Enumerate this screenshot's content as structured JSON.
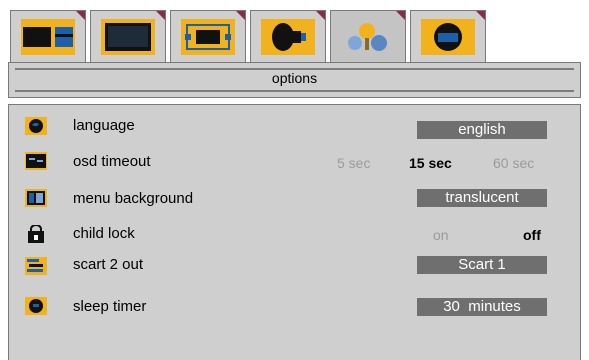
{
  "tabs": [
    {
      "name": "tab-picture-settings",
      "icon": "picture-settings-icon"
    },
    {
      "name": "tab-screen",
      "icon": "screen-icon"
    },
    {
      "name": "tab-picture-size",
      "icon": "picture-size-icon"
    },
    {
      "name": "tab-sound",
      "icon": "speaker-icon"
    },
    {
      "name": "tab-features",
      "icon": "lightbulb-icon"
    },
    {
      "name": "tab-options",
      "icon": "options-icon"
    }
  ],
  "page_title": "options",
  "rows": {
    "language": {
      "label": "language",
      "value": "english",
      "icon": "globe-icon"
    },
    "osd_timeout": {
      "label": "osd timeout",
      "options": [
        "5 sec",
        "15 sec",
        "60 sec"
      ],
      "selected": "15 sec",
      "icon": "osd-timeout-icon"
    },
    "menu_background": {
      "label": "menu background",
      "value": "translucent",
      "icon": "menu-background-icon"
    },
    "child_lock": {
      "label": "child lock",
      "options": [
        "on",
        "off"
      ],
      "selected": "off",
      "icon": "lock-icon"
    },
    "scart2_out": {
      "label": "scart 2 out",
      "value": "Scart 1",
      "icon": "scart-icon"
    },
    "sleep_timer": {
      "label": "sleep timer",
      "value": "30  minutes",
      "icon": "clock-icon"
    }
  },
  "colors": {
    "accent": "#f2b21b",
    "panel": "#cfcfcf",
    "value_box": "#6f6f6f",
    "tab_corner": "#8c2a4a"
  }
}
